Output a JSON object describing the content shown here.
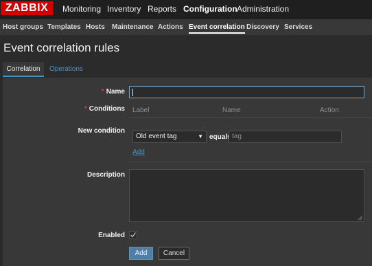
{
  "header": {
    "logo_text": "ZABBIX",
    "main_nav": [
      {
        "label": "Monitoring"
      },
      {
        "label": "Inventory"
      },
      {
        "label": "Reports"
      },
      {
        "label": "Configuration",
        "active": true
      },
      {
        "label": "Administration"
      }
    ]
  },
  "subnav": [
    {
      "label": "Host groups"
    },
    {
      "label": "Templates"
    },
    {
      "label": "Hosts"
    },
    {
      "label": "Maintenance"
    },
    {
      "label": "Actions"
    },
    {
      "label": "Event correlation",
      "active": true
    },
    {
      "label": "Discovery"
    },
    {
      "label": "Services"
    }
  ],
  "page": {
    "title": "Event correlation rules"
  },
  "tabs": [
    {
      "label": "Correlation",
      "active": true
    },
    {
      "label": "Operations"
    }
  ],
  "form": {
    "name_label": "Name",
    "name_value": "",
    "conditions_label": "Conditions",
    "conditions_columns": [
      "Label",
      "Name",
      "Action"
    ],
    "new_condition_label": "New condition",
    "new_condition_type": "Old event tag",
    "operator": "equals",
    "tag_placeholder": "tag",
    "add_link": "Add",
    "description_label": "Description",
    "description_value": "",
    "enabled_label": "Enabled",
    "enabled_checked": true
  },
  "buttons": {
    "add": "Add",
    "cancel": "Cancel"
  },
  "colors": {
    "brand": "#d40000",
    "link": "#4796c4",
    "primary_button": "#4f7ea7",
    "required_marker": "#e33734"
  }
}
